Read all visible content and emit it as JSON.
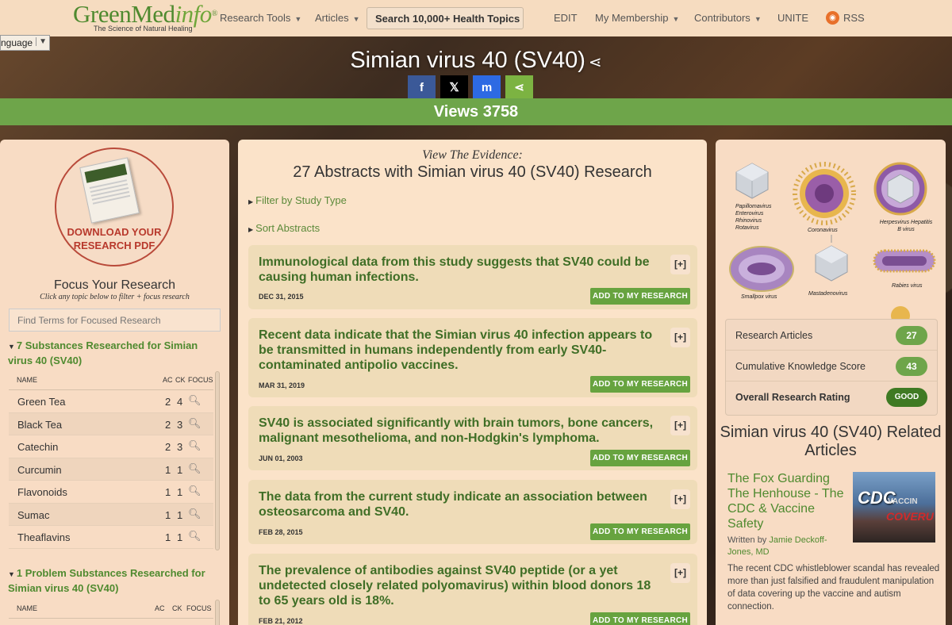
{
  "nav": {
    "logo_green": "GreenMed",
    "logo_italic": "info",
    "logo_reg": "®",
    "logo_tagline": "The Science of Natural Healing",
    "research_tools": "Research Tools",
    "articles": "Articles",
    "search": "Search 10,000+ Health Topics",
    "edit": "EDIT",
    "membership": "My Membership",
    "contributors": "Contributors",
    "unite": "UNITE",
    "rss": "RSS"
  },
  "language": {
    "label": "nguage"
  },
  "hero": {
    "title": "Simian virus 40 (SV40)",
    "share_buttons": [
      "f",
      "𝕏",
      "m",
      "⋖"
    ],
    "views": "Views 3758"
  },
  "left": {
    "pdf_label": "DOWNLOAD YOUR RESEARCH PDF",
    "focus_title": "Focus Your Research",
    "focus_subtitle": "Click any topic below to filter + focus research",
    "find_placeholder": "Find Terms for Focused Research",
    "substances_heading": "7 Substances Researched for Simian virus 40 (SV40)",
    "problem_heading": "1 Problem Substances Researched for Simian virus 40 (SV40)",
    "col_name": "NAME",
    "col_ac": "AC",
    "col_ck": "CK",
    "col_focus": "FOCUS",
    "substances": [
      {
        "name": "Green Tea",
        "ac": "2",
        "ck": "4"
      },
      {
        "name": "Black Tea",
        "ac": "2",
        "ck": "3"
      },
      {
        "name": "Catechin",
        "ac": "2",
        "ck": "3"
      },
      {
        "name": "Curcumin",
        "ac": "1",
        "ck": "1"
      },
      {
        "name": "Flavonoids",
        "ac": "1",
        "ck": "1"
      },
      {
        "name": "Sumac",
        "ac": "1",
        "ck": "1"
      },
      {
        "name": "Theaflavins",
        "ac": "1",
        "ck": "1"
      }
    ]
  },
  "center": {
    "evidence_label": "View The Evidence:",
    "abstracts_title": "27 Abstracts with Simian virus 40 (SV40) Research",
    "filter_label": "Filter by Study Type",
    "sort_label": "Sort Abstracts",
    "plus_label": "[+]",
    "add_label": "ADD TO MY RESEARCH",
    "abstracts": [
      {
        "title": "Immunological data from this study suggests that SV40 could be causing human infections.",
        "date": "DEC 31, 2015"
      },
      {
        "title": "Recent data indicate that the Simian virus 40 infection appears to be transmitted in humans independently from early SV40-contaminated antipolio vaccines.",
        "date": "MAR 31, 2019"
      },
      {
        "title": "SV40 is associated significantly with brain tumors, bone cancers, malignant mesothelioma, and non-Hodgkin's lymphoma.",
        "date": "JUN 01, 2003"
      },
      {
        "title": "The data from the current study indicate an association between osteosarcoma and SV40.",
        "date": "FEB 28, 2015"
      },
      {
        "title": "The prevalence of antibodies against SV40 peptide (or a yet undetected closely related polyomavirus) within blood donors 18 to 65 years old is 18%.",
        "date": "FEB 21, 2012"
      }
    ]
  },
  "right": {
    "virus_labels": {
      "papilloma": "Papillomavirus Enterovirus Rhinovirus Rotavirus",
      "corona": "Coronavirus",
      "herpes": "Herpesvirus Hepatitis B virus",
      "smallpox": "Smallpox virus",
      "mastadeno": "Mastadenovirus",
      "rabies": "Rabies virus"
    },
    "scores": [
      {
        "label": "Research Articles",
        "value": "27"
      },
      {
        "label": "Cumulative Knowledge Score",
        "value": "43"
      },
      {
        "label": "Overall Research Rating",
        "value": "GOOD"
      }
    ],
    "related_title": "Simian virus 40 (SV40) Related Articles",
    "related": {
      "title": "The Fox Guarding The Henhouse - The CDC & Vaccine Safety",
      "written_by": "Written by ",
      "author": "Jamie Deckoff-Jones, MD",
      "img_cdc": "CDC",
      "img_vaccine": "VACCIN",
      "img_coverup": "COVERU",
      "description": "The recent CDC whistleblower scandal has revealed more than just falsified and fraudulent manipulation of data covering up the vaccine and autism connection."
    }
  },
  "colors": {
    "brand_green": "#4f8a2f",
    "views_bar": "#6ea54a",
    "add_button": "#67a33f",
    "pdf_red": "#b8392c",
    "facebook": "#3b5998",
    "x": "#000000",
    "messenger": "#2d6ae3",
    "sharethis": "#7cb342"
  }
}
